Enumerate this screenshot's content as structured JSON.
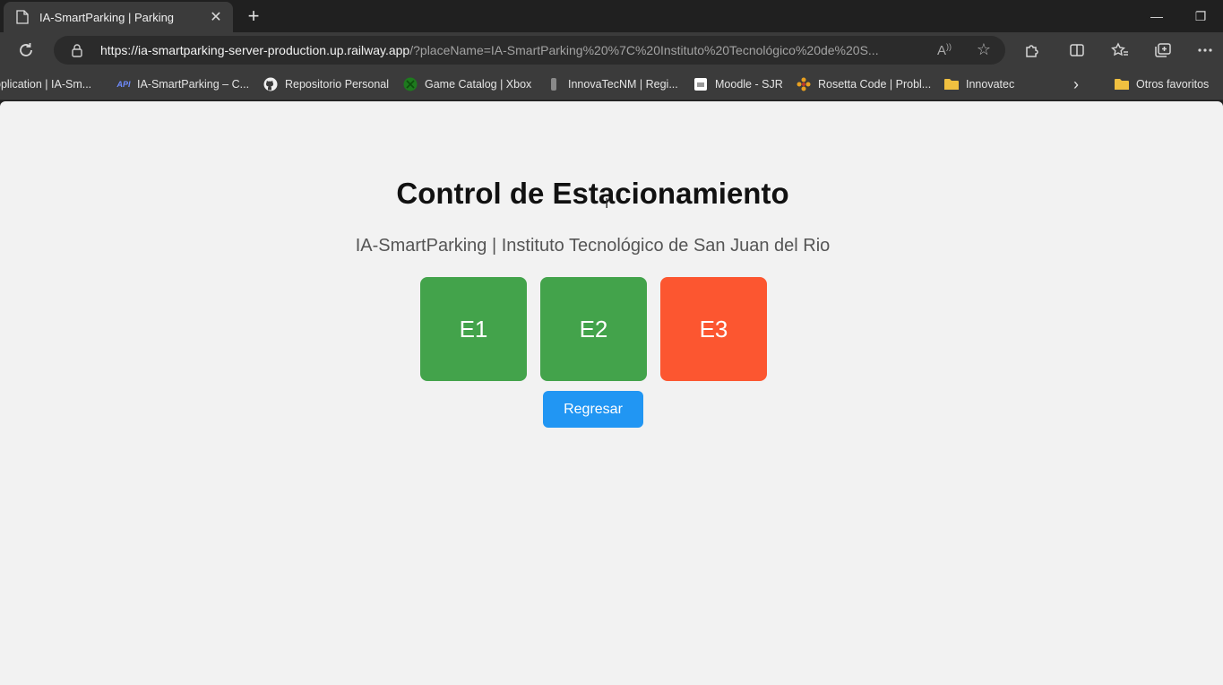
{
  "browser": {
    "tab": {
      "title": "IA-SmartParking | Parking",
      "close_label": "✕"
    },
    "new_tab_label": "+",
    "window": {
      "minimize": "—",
      "restore": "❐"
    },
    "address": {
      "url_host": "https://ia-smartparking-server-production.up.railway.app",
      "url_rest": "/?placeName=IA-SmartParking%20%7C%20Instituto%20Tecnológico%20de%20S..."
    },
    "bookmarks": [
      {
        "label": "pplication | IA-Sm...",
        "icon": "doc-icon"
      },
      {
        "label": "IA-SmartParking – C...",
        "icon": "api-icon",
        "icon_text": "API"
      },
      {
        "label": "Repositorio Personal",
        "icon": "github-icon"
      },
      {
        "label": "Game Catalog | Xbox",
        "icon": "xbox-icon"
      },
      {
        "label": "InnovaTecNM | Regi...",
        "icon": "innova-icon"
      },
      {
        "label": "Moodle - SJR",
        "icon": "moodle-icon"
      },
      {
        "label": "Rosetta Code | Probl...",
        "icon": "rosetta-icon"
      },
      {
        "label": "Innovatec",
        "icon": "folder-icon"
      }
    ],
    "bookmarks_more": "›",
    "other_favorites": "Otros favoritos"
  },
  "page": {
    "title": "Control de Estacionamiento",
    "subtitle": "IA-SmartParking | Instituto Tecnológico de San Juan del Rio",
    "slots": [
      {
        "label": "E1",
        "status": "free",
        "color": "#43a34b"
      },
      {
        "label": "E2",
        "status": "free",
        "color": "#43a34b"
      },
      {
        "label": "E3",
        "status": "occupied",
        "color": "#fc5630"
      }
    ],
    "back_button": {
      "label": "Regresar",
      "color": "#2196f3"
    }
  },
  "colors": {
    "page_background": "#f2f2f2",
    "chrome_dark": "#202020",
    "chrome_toolbar": "#3b3b3b"
  }
}
